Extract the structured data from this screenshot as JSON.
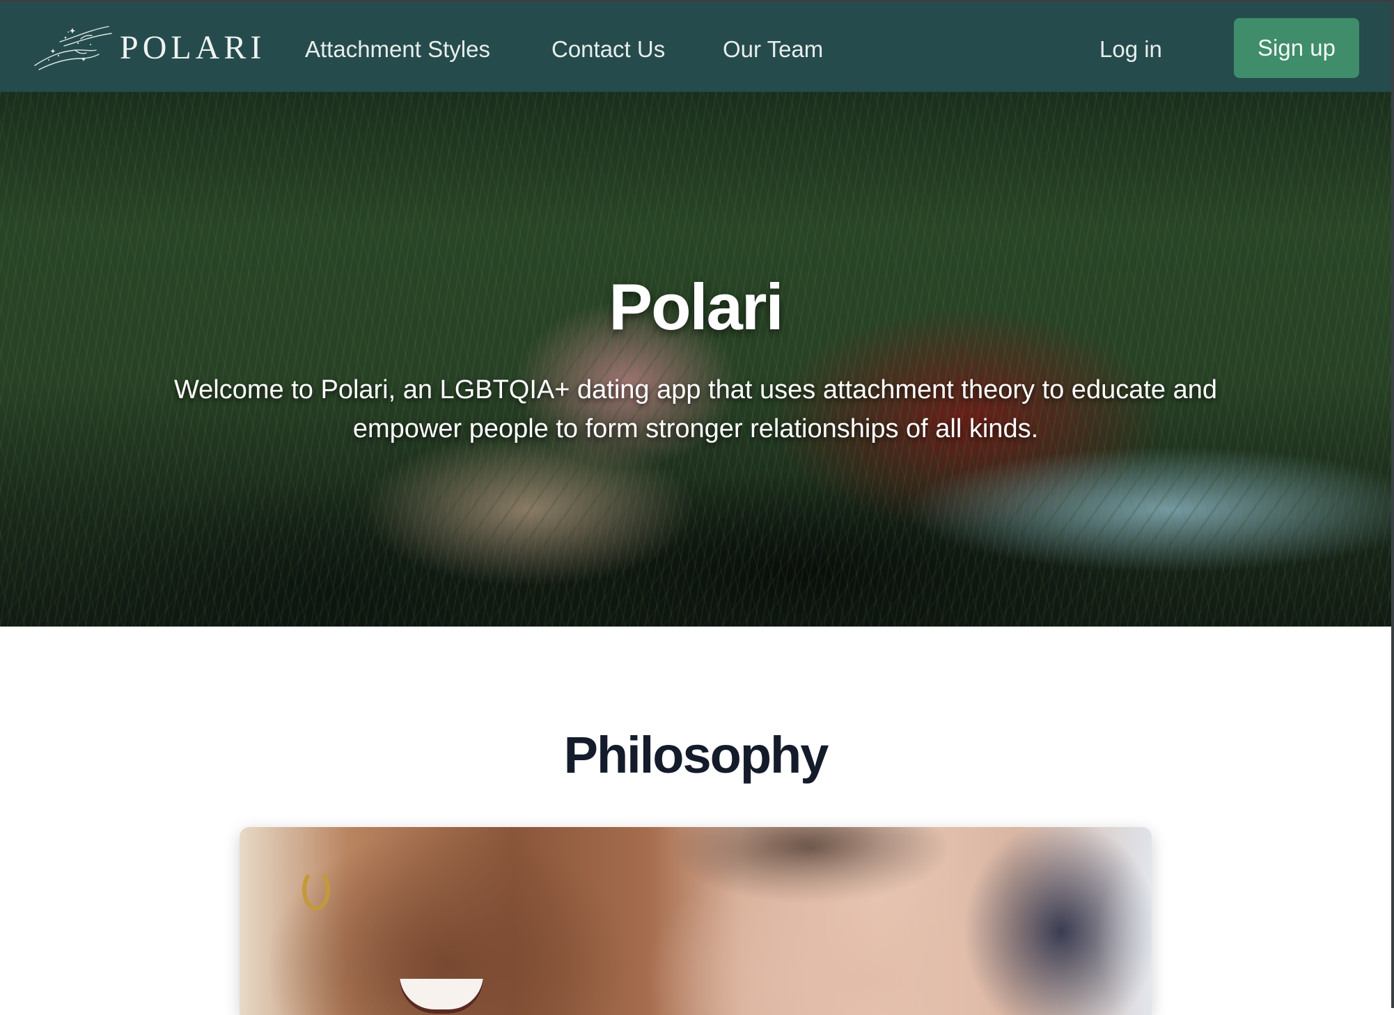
{
  "brand": {
    "name": "POLARI"
  },
  "nav": {
    "links": [
      {
        "label": "Attachment Styles"
      },
      {
        "label": "Contact Us"
      },
      {
        "label": "Our Team"
      }
    ],
    "login_label": "Log in",
    "signup_label": "Sign up"
  },
  "hero": {
    "title": "Polari",
    "subtitle": "Welcome to Polari, an LGBTQIA+ dating app that uses attachment theory to educate and empower people to form stronger relationships of all kinds."
  },
  "philosophy": {
    "title": "Philosophy"
  },
  "colors": {
    "navbar": "#264b4c",
    "signup_button": "#3f8d6b",
    "heading": "#141b2b",
    "nav_text": "#e7eeec"
  },
  "icons": {
    "logo": "hands-stars-logo-icon"
  }
}
